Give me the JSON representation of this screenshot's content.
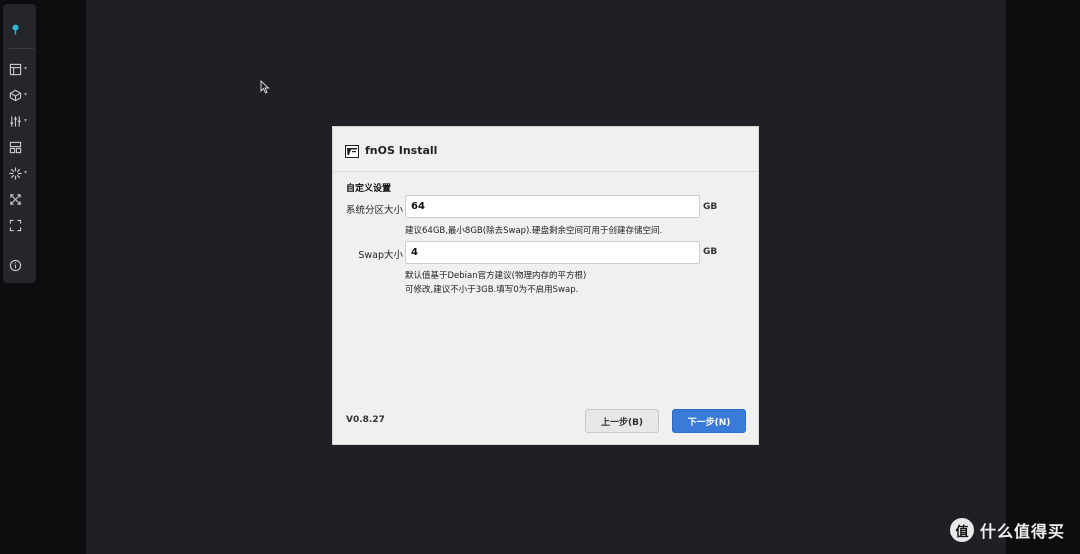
{
  "dialog": {
    "title": "fnOS Install",
    "section_title": "自定义设置",
    "system_partition": {
      "label": "系统分区大小",
      "value": "64",
      "unit": "GB",
      "hint": "建议64GB,最小8GB(除去Swap).硬盘剩余空间可用于创建存储空间."
    },
    "swap": {
      "label": "Swap大小",
      "value": "4",
      "unit": "GB",
      "hint_line1": "默认值基于Debian官方建议(物理内存的平方根)",
      "hint_line2": "可修改,建议不小于3GB.填写0为不启用Swap."
    },
    "version": "V0.8.27",
    "prev_button": "上一步(B)",
    "next_button": "下一步(N)"
  },
  "toolbar": {
    "items": [
      "pin-icon",
      "layout-icon",
      "cube-icon",
      "sliders-icon",
      "dashboard-icon",
      "spinner-icon",
      "expand-icon",
      "fullscreen-icon",
      "info-icon"
    ]
  },
  "watermark": {
    "logo_char": "值",
    "text": "什么值得买"
  },
  "colors": {
    "accent_blue": "#3a7ad8",
    "pin_cyan": "#2fb8d8",
    "screen_bg": "#1f2025"
  }
}
